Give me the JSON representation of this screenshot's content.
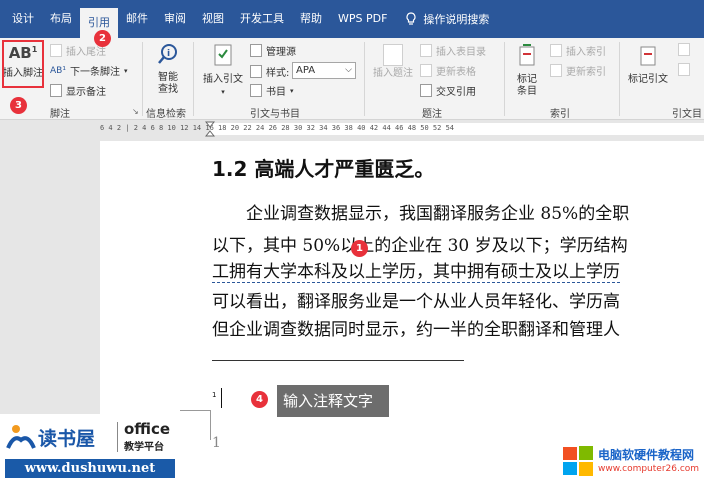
{
  "menu": {
    "tabs": [
      "设计",
      "布局",
      "引用",
      "邮件",
      "审阅",
      "视图",
      "开发工具",
      "帮助",
      "WPS PDF"
    ],
    "active_tab": "引用",
    "tell_me": "操作说明搜索"
  },
  "ribbon": {
    "footnotes": {
      "insert_footnote": "插入脚注",
      "insert_endnote": "插入尾注",
      "next_footnote": "下一条脚注",
      "show_notes": "显示备注",
      "group_label": "脚注"
    },
    "research": {
      "smart_lookup_line1": "智能",
      "smart_lookup_line2": "查找",
      "group_label": "信息检索"
    },
    "citations": {
      "insert_citation": "插入引文",
      "manage_sources": "管理源",
      "style_label": "样式:",
      "style_value": "APA",
      "bibliography": "书目",
      "group_label": "引文与书目"
    },
    "captions": {
      "insert_caption": "插入题注",
      "insert_table_of_figures": "插入表目录",
      "update_table": "更新表格",
      "cross_reference": "交叉引用",
      "group_label": "题注"
    },
    "index": {
      "mark_entry_line1": "标记",
      "mark_entry_line2": "条目",
      "insert_index": "插入索引",
      "update_index": "更新索引",
      "group_label": "索引"
    },
    "toa": {
      "mark_citation": "标记引文",
      "group_label": "引文目"
    }
  },
  "ruler_text": "6 4 2 | 2 4 6 8 10 12 14 16 18 20 22 24 26 28 30 32 34 36 38 40 42 44 46 48 50 52 54",
  "document": {
    "heading": "1.2  高端人才严重匮乏。",
    "lines": [
      "　　企业调查数据显示，我国翻译服务企业 85%的全职",
      "以下，其中 50%以上的企业在 30 岁及以下；学历结构",
      "工拥有大学本科及以上学历，其中拥有硕士及以上学历",
      "可以看出，翻译服务业是一个从业人员年轻化、学历高",
      "但企业调查数据同时显示，约一半的全职翻译和管理人"
    ],
    "footnote_marker": "1",
    "footnote_marker_margin": "1",
    "tooltip": "输入注释文字"
  },
  "steps": [
    "1",
    "2",
    "3",
    "4"
  ],
  "watermark_left": {
    "title": "读书屋",
    "brand": "office",
    "subtitle": "教学平台",
    "url": "www.dushuwu.net"
  },
  "watermark_right": {
    "title": "电脑软硬件教程网",
    "url": "www.computer26.com"
  },
  "colors": {
    "accent": "#2b579a",
    "badge": "#e8313b"
  }
}
